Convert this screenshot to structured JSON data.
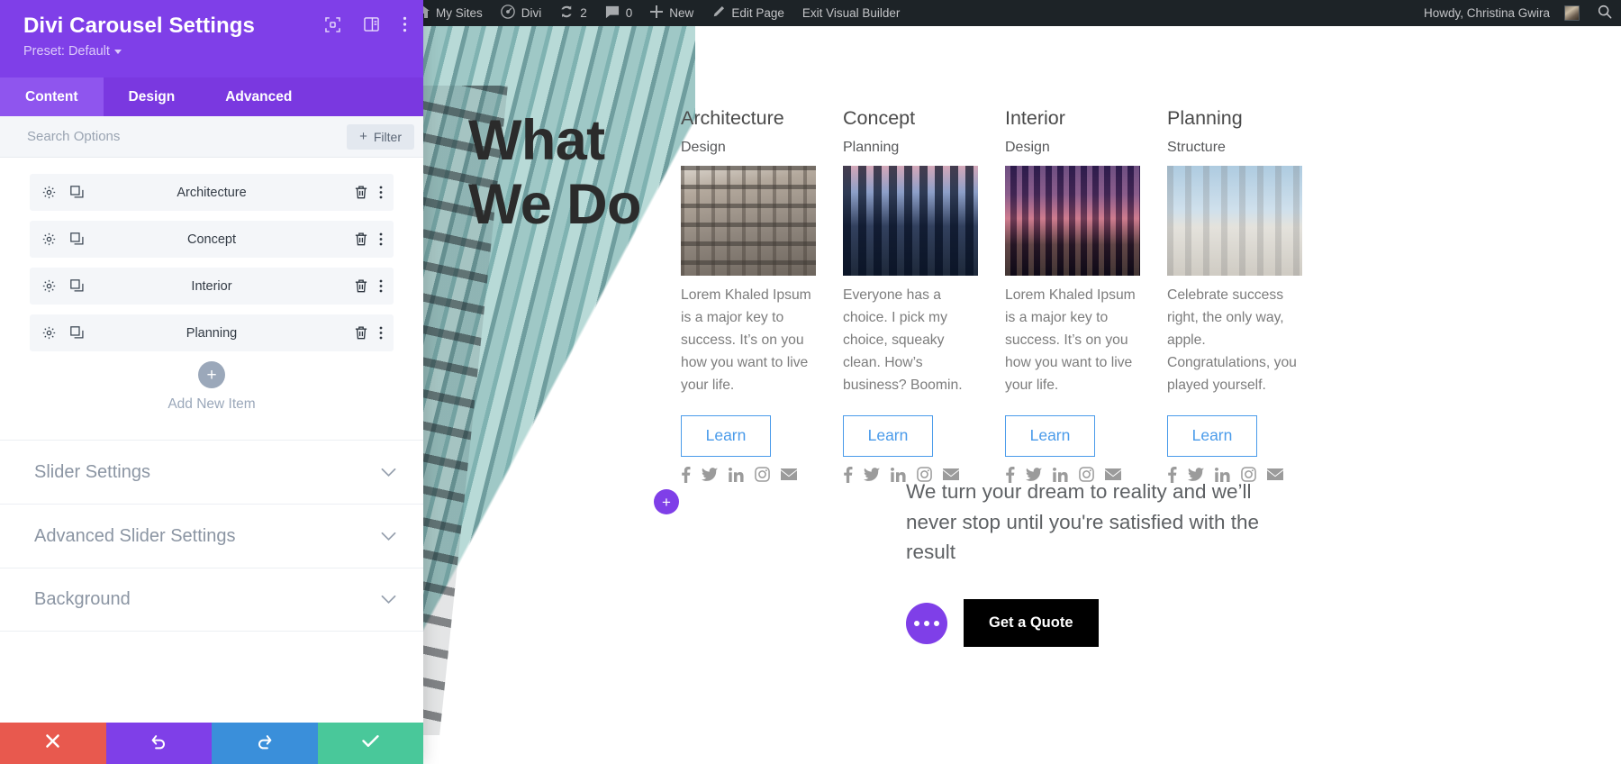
{
  "panel": {
    "title": "Divi Carousel Settings",
    "preset": "Preset: Default",
    "head_icons": [
      "fullscreen-icon",
      "layout-icon",
      "more-vertical-icon"
    ],
    "tabs": [
      {
        "label": "Content",
        "active": true
      },
      {
        "label": "Design",
        "active": false
      },
      {
        "label": "Advanced",
        "active": false
      }
    ],
    "search": {
      "placeholder": "Search Options",
      "value": ""
    },
    "filter_label": "Filter",
    "items": [
      {
        "label": "Architecture"
      },
      {
        "label": "Concept"
      },
      {
        "label": "Interior"
      },
      {
        "label": "Planning"
      }
    ],
    "add_new_label": "Add New Item",
    "toggles": [
      {
        "label": "Slider Settings"
      },
      {
        "label": "Advanced Slider Settings"
      },
      {
        "label": "Background"
      }
    ],
    "footer": [
      {
        "name": "cancel",
        "icon": "close-icon",
        "color": "#E8594E"
      },
      {
        "name": "undo",
        "icon": "undo-icon",
        "color": "#7F3FE8"
      },
      {
        "name": "redo",
        "icon": "redo-icon",
        "color": "#3A8FDA"
      },
      {
        "name": "save",
        "icon": "check-icon",
        "color": "#49C89A"
      }
    ]
  },
  "adminbar": {
    "wp_logo": "wordpress-icon",
    "items": [
      {
        "label": "My Sites",
        "icon": "sites-icon"
      },
      {
        "label": "Divi",
        "icon": "dashboard-icon"
      },
      {
        "label": "2",
        "icon": "updates-icon"
      },
      {
        "label": "0",
        "icon": "comments-icon"
      },
      {
        "label": "New",
        "icon": "plus-icon"
      },
      {
        "label": "Edit Page",
        "icon": "pencil-icon"
      },
      {
        "label": "Exit Visual Builder",
        "icon": ""
      }
    ],
    "howdy": "Howdy, Christina Gwira",
    "search_icon": "search-icon"
  },
  "page": {
    "headline_line1": "What",
    "headline_line2": "We Do",
    "cards": [
      {
        "title": "Architecture",
        "subtitle": "Design",
        "image": "office-building-photo",
        "body": "Lorem Khaled Ipsum is a major key to success. It’s on you how you want to live your life.",
        "button": "Learn"
      },
      {
        "title": "Concept",
        "subtitle": "Planning",
        "image": "city-skyline-photo",
        "body": "Everyone has a choice. I pick my choice, squeaky clean. How’s business? Boomin.",
        "button": "Learn"
      },
      {
        "title": "Interior",
        "subtitle": "Design",
        "image": "night-street-photo",
        "body": "Lorem Khaled Ipsum is a major key to success. It’s on you how you want to live your life.",
        "button": "Learn"
      },
      {
        "title": "Planning",
        "subtitle": "Structure",
        "image": "white-facade-photo",
        "body": "Celebrate success right, the only way, apple. Congratulations, you played yourself.",
        "button": "Learn"
      }
    ],
    "social_icons": [
      "facebook-icon",
      "twitter-icon",
      "linkedin-icon",
      "instagram-icon",
      "email-icon"
    ],
    "tagline": "We turn your dream to reality and we’ll never stop until you're satisfied with the result",
    "quote_button": "Get a Quote"
  },
  "colors": {
    "brand_purple": "#7F3FE8",
    "tab_active": "#8F55EE",
    "admin_bar": "#1D2327",
    "learn_blue": "#4A9BEA",
    "quote_black": "#000000"
  }
}
